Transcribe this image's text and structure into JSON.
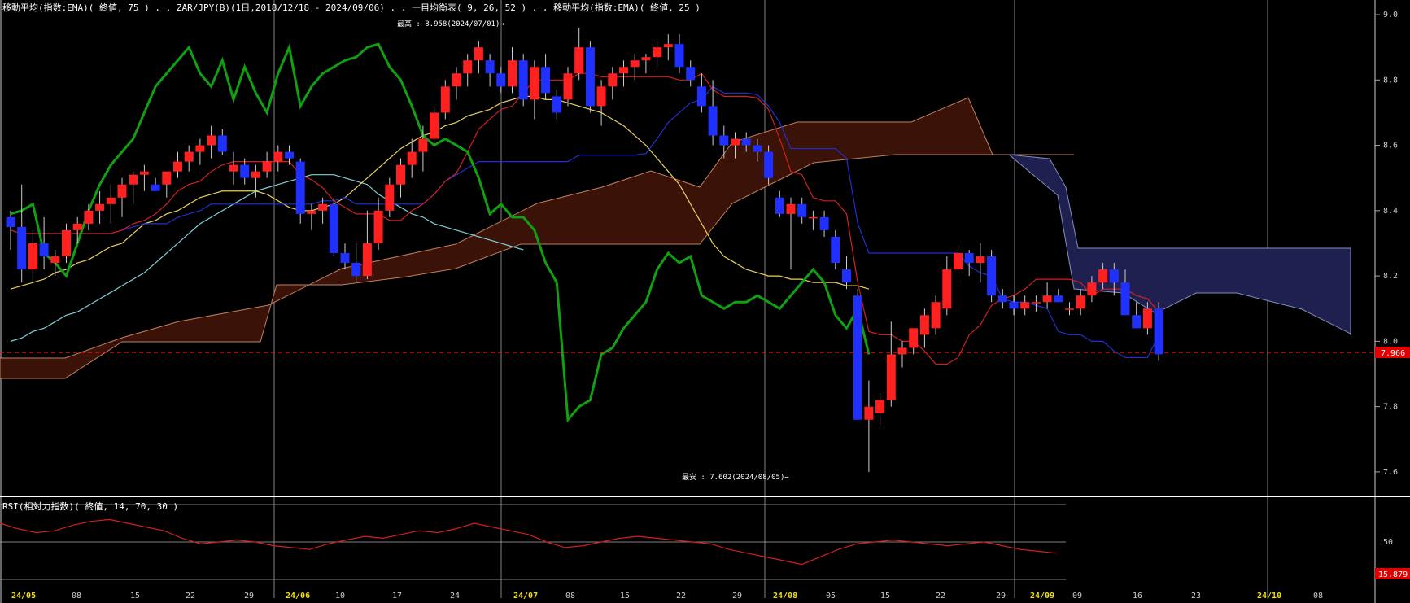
{
  "window": {
    "header_main": "移動平均(指数:EMA)( 終値, 75 ) . . ZAR/JPY(B)(1日,2018/12/18 - 2024/09/06) . . 一目均衡表( 9, 26, 52 ) . . 移動平均(指数:EMA)( 終値, 25 )",
    "header_rsi": "RSI(相対力指数)( 終値, 14, 70, 30 )"
  },
  "annotations": {
    "high": "最高 : 8.958(2024/07/01)→",
    "low": "最安 : 7.602(2024/08/05)→"
  },
  "price_axis": {
    "ticks": [
      "9.0",
      "8.8",
      "8.6",
      "8.4",
      "8.2",
      "8.0",
      "7.8",
      "7.6"
    ],
    "last_price": "7.966"
  },
  "rsi_axis": {
    "tick_50": "50",
    "last_value": "15.879"
  },
  "x_axis": {
    "ticks": [
      "24/05",
      "08",
      "15",
      "22",
      "29",
      "24/06",
      "10",
      "17",
      "24",
      "24/07",
      "08",
      "15",
      "22",
      "29",
      "24/08",
      "05",
      "15",
      "22",
      "29",
      "24/09",
      "09",
      "16",
      "23",
      "24/10",
      "08"
    ],
    "major": [
      "24/05",
      "24/06",
      "24/07",
      "24/08",
      "24/09",
      "24/10"
    ]
  },
  "colors": {
    "up": "#ff2020",
    "down": "#2030ff",
    "ema25": "#e8d060",
    "ema75": "#80d0d8",
    "tenkan": "#d02020",
    "kijun": "#2030d0",
    "chikou": "#10a010",
    "kumo_bull": "#3a1208",
    "kumo_bear": "#202050",
    "rsi": "#d02020"
  },
  "chart_data": {
    "type": "candlestick",
    "title": "ZAR/JPY(B)",
    "ylim": [
      7.55,
      9.02
    ],
    "candles": [
      [
        8.38,
        8.4,
        8.28,
        8.35
      ],
      [
        8.35,
        8.48,
        8.18,
        8.22
      ],
      [
        8.22,
        8.34,
        8.18,
        8.3
      ],
      [
        8.3,
        8.38,
        8.22,
        8.26
      ],
      [
        8.24,
        8.28,
        8.2,
        8.26
      ],
      [
        8.26,
        8.36,
        8.24,
        8.34
      ],
      [
        8.34,
        8.38,
        8.3,
        8.36
      ],
      [
        8.36,
        8.42,
        8.34,
        8.4
      ],
      [
        8.4,
        8.46,
        8.36,
        8.42
      ],
      [
        8.42,
        8.48,
        8.36,
        8.44
      ],
      [
        8.44,
        8.5,
        8.38,
        8.48
      ],
      [
        8.48,
        8.52,
        8.42,
        8.51
      ],
      [
        8.51,
        8.54,
        8.46,
        8.52
      ],
      [
        8.48,
        8.5,
        8.46,
        8.46
      ],
      [
        8.48,
        8.52,
        8.44,
        8.52
      ],
      [
        8.52,
        8.58,
        8.5,
        8.55
      ],
      [
        8.55,
        8.6,
        8.52,
        8.58
      ],
      [
        8.58,
        8.62,
        8.54,
        8.6
      ],
      [
        8.6,
        8.66,
        8.56,
        8.63
      ],
      [
        8.63,
        8.65,
        8.57,
        8.58
      ],
      [
        8.52,
        8.58,
        8.48,
        8.54
      ],
      [
        8.54,
        8.56,
        8.48,
        8.5
      ],
      [
        8.5,
        8.54,
        8.44,
        8.52
      ],
      [
        8.52,
        8.58,
        8.5,
        8.55
      ],
      [
        8.55,
        8.6,
        8.52,
        8.58
      ],
      [
        8.58,
        8.6,
        8.54,
        8.56
      ],
      [
        8.55,
        8.56,
        8.36,
        8.39
      ],
      [
        8.39,
        8.42,
        8.34,
        8.4
      ],
      [
        8.4,
        8.44,
        8.36,
        8.42
      ],
      [
        8.42,
        8.44,
        8.26,
        8.27
      ],
      [
        8.27,
        8.3,
        8.22,
        8.24
      ],
      [
        8.24,
        8.3,
        8.18,
        8.2
      ],
      [
        8.2,
        8.4,
        8.19,
        8.3
      ],
      [
        8.3,
        8.44,
        8.28,
        8.4
      ],
      [
        8.4,
        8.5,
        8.38,
        8.48
      ],
      [
        8.48,
        8.56,
        8.44,
        8.54
      ],
      [
        8.54,
        8.62,
        8.5,
        8.58
      ],
      [
        8.58,
        8.66,
        8.52,
        8.62
      ],
      [
        8.62,
        8.72,
        8.6,
        8.7
      ],
      [
        8.7,
        8.8,
        8.68,
        8.78
      ],
      [
        8.78,
        8.84,
        8.74,
        8.82
      ],
      [
        8.82,
        8.88,
        8.78,
        8.86
      ],
      [
        8.86,
        8.92,
        8.82,
        8.9
      ],
      [
        8.86,
        8.88,
        8.78,
        8.82
      ],
      [
        8.82,
        8.84,
        8.76,
        8.78
      ],
      [
        8.78,
        8.9,
        8.76,
        8.86
      ],
      [
        8.86,
        8.88,
        8.72,
        8.74
      ],
      [
        8.74,
        8.86,
        8.68,
        8.84
      ],
      [
        8.84,
        8.88,
        8.74,
        8.76
      ],
      [
        8.75,
        8.77,
        8.68,
        8.7
      ],
      [
        8.74,
        8.84,
        8.72,
        8.82
      ],
      [
        8.82,
        8.96,
        8.8,
        8.9
      ],
      [
        8.9,
        8.92,
        8.7,
        8.72
      ],
      [
        8.72,
        8.8,
        8.66,
        8.78
      ],
      [
        8.78,
        8.84,
        8.74,
        8.82
      ],
      [
        8.82,
        8.86,
        8.78,
        8.84
      ],
      [
        8.84,
        8.88,
        8.8,
        8.86
      ],
      [
        8.86,
        8.88,
        8.82,
        8.87
      ],
      [
        8.87,
        8.92,
        8.84,
        8.9
      ],
      [
        8.9,
        8.94,
        8.86,
        8.91
      ],
      [
        8.91,
        8.94,
        8.82,
        8.84
      ],
      [
        8.84,
        8.86,
        8.78,
        8.8
      ],
      [
        8.78,
        8.82,
        8.7,
        8.72
      ],
      [
        8.72,
        8.8,
        8.6,
        8.63
      ],
      [
        8.63,
        8.66,
        8.56,
        8.6
      ],
      [
        8.6,
        8.64,
        8.56,
        8.62
      ],
      [
        8.62,
        8.64,
        8.58,
        8.6
      ],
      [
        8.6,
        8.62,
        8.55,
        8.58
      ],
      [
        8.58,
        8.6,
        8.48,
        8.5
      ],
      [
        8.44,
        8.46,
        8.38,
        8.39
      ],
      [
        8.39,
        8.44,
        8.22,
        8.42
      ],
      [
        8.42,
        8.44,
        8.36,
        8.38
      ],
      [
        8.38,
        8.4,
        8.34,
        8.38
      ],
      [
        8.38,
        8.4,
        8.32,
        8.34
      ],
      [
        8.32,
        8.34,
        8.22,
        8.24
      ],
      [
        8.22,
        8.26,
        8.16,
        8.18
      ],
      [
        8.14,
        8.16,
        7.76,
        7.76
      ],
      [
        7.76,
        7.88,
        7.6,
        7.8
      ],
      [
        7.78,
        7.84,
        7.74,
        7.82
      ],
      [
        7.82,
        8.06,
        7.8,
        7.96
      ],
      [
        7.96,
        8.0,
        7.92,
        7.98
      ],
      [
        7.98,
        8.04,
        7.96,
        8.04
      ],
      [
        8.02,
        8.1,
        7.98,
        8.08
      ],
      [
        8.04,
        8.14,
        8.02,
        8.12
      ],
      [
        8.1,
        8.26,
        8.08,
        8.22
      ],
      [
        8.22,
        8.3,
        8.18,
        8.27
      ],
      [
        8.27,
        8.28,
        8.2,
        8.24
      ],
      [
        8.24,
        8.3,
        8.18,
        8.26
      ],
      [
        8.26,
        8.28,
        8.12,
        8.14
      ],
      [
        8.14,
        8.16,
        8.1,
        8.12
      ],
      [
        8.12,
        8.14,
        8.08,
        8.1
      ],
      [
        8.1,
        8.14,
        8.08,
        8.12
      ],
      [
        8.12,
        8.14,
        8.09,
        8.12
      ],
      [
        8.12,
        8.18,
        8.1,
        8.14
      ],
      [
        8.14,
        8.16,
        8.12,
        8.12
      ],
      [
        8.1,
        8.12,
        8.08,
        8.1
      ],
      [
        8.1,
        8.16,
        8.08,
        8.14
      ],
      [
        8.14,
        8.2,
        8.12,
        8.18
      ],
      [
        8.18,
        8.24,
        8.16,
        8.22
      ],
      [
        8.22,
        8.24,
        8.14,
        8.18
      ],
      [
        8.18,
        8.22,
        8.08,
        8.08
      ],
      [
        8.08,
        8.12,
        8.04,
        8.04
      ],
      [
        8.04,
        8.12,
        8.02,
        8.1
      ],
      [
        8.1,
        8.12,
        7.94,
        7.96
      ]
    ],
    "ema25": [
      8.16,
      8.17,
      8.18,
      8.19,
      8.21,
      8.22,
      8.24,
      8.25,
      8.27,
      8.29,
      8.3,
      8.33,
      8.36,
      8.37,
      8.39,
      8.4,
      8.42,
      8.44,
      8.45,
      8.46,
      8.46,
      8.46,
      8.46,
      8.45,
      8.43,
      8.41,
      8.4,
      8.4,
      8.41,
      8.42,
      8.44,
      8.47,
      8.5,
      8.53,
      8.56,
      8.59,
      8.61,
      8.63,
      8.64,
      8.66,
      8.67,
      8.69,
      8.7,
      8.71,
      8.73,
      8.74,
      8.75,
      8.75,
      8.74,
      8.74,
      8.73,
      8.72,
      8.71,
      8.7,
      8.68,
      8.66,
      8.63,
      8.6,
      8.56,
      8.52,
      8.48,
      8.42,
      8.36,
      8.3,
      8.26,
      8.24,
      8.22,
      8.21,
      8.2,
      8.2,
      8.19,
      8.19,
      8.18,
      8.18,
      8.18,
      8.17,
      8.17,
      8.16
    ],
    "ema75": [
      8.0,
      8.01,
      8.03,
      8.04,
      8.06,
      8.08,
      8.09,
      8.11,
      8.13,
      8.15,
      8.17,
      8.19,
      8.21,
      8.24,
      8.27,
      8.3,
      8.33,
      8.36,
      8.38,
      8.4,
      8.42,
      8.44,
      8.46,
      8.47,
      8.48,
      8.49,
      8.5,
      8.51,
      8.51,
      8.51,
      8.5,
      8.49,
      8.48,
      8.45,
      8.43,
      8.41,
      8.39,
      8.38,
      8.36,
      8.35,
      8.34,
      8.33,
      8.32,
      8.31,
      8.3,
      8.29,
      8.28
    ],
    "rsi": [
      60,
      57,
      55,
      56,
      59,
      61,
      62,
      60,
      58,
      56,
      52,
      49,
      50,
      51,
      50,
      48,
      47,
      46,
      49,
      51,
      53,
      52,
      54,
      56,
      55,
      57,
      60,
      58,
      56,
      54,
      50,
      47,
      48,
      50,
      52,
      53,
      52,
      51,
      50,
      49,
      46,
      44,
      42,
      40,
      38,
      42,
      46,
      49,
      50,
      51,
      50,
      49,
      48,
      49,
      50,
      48,
      46,
      45,
      44
    ]
  }
}
